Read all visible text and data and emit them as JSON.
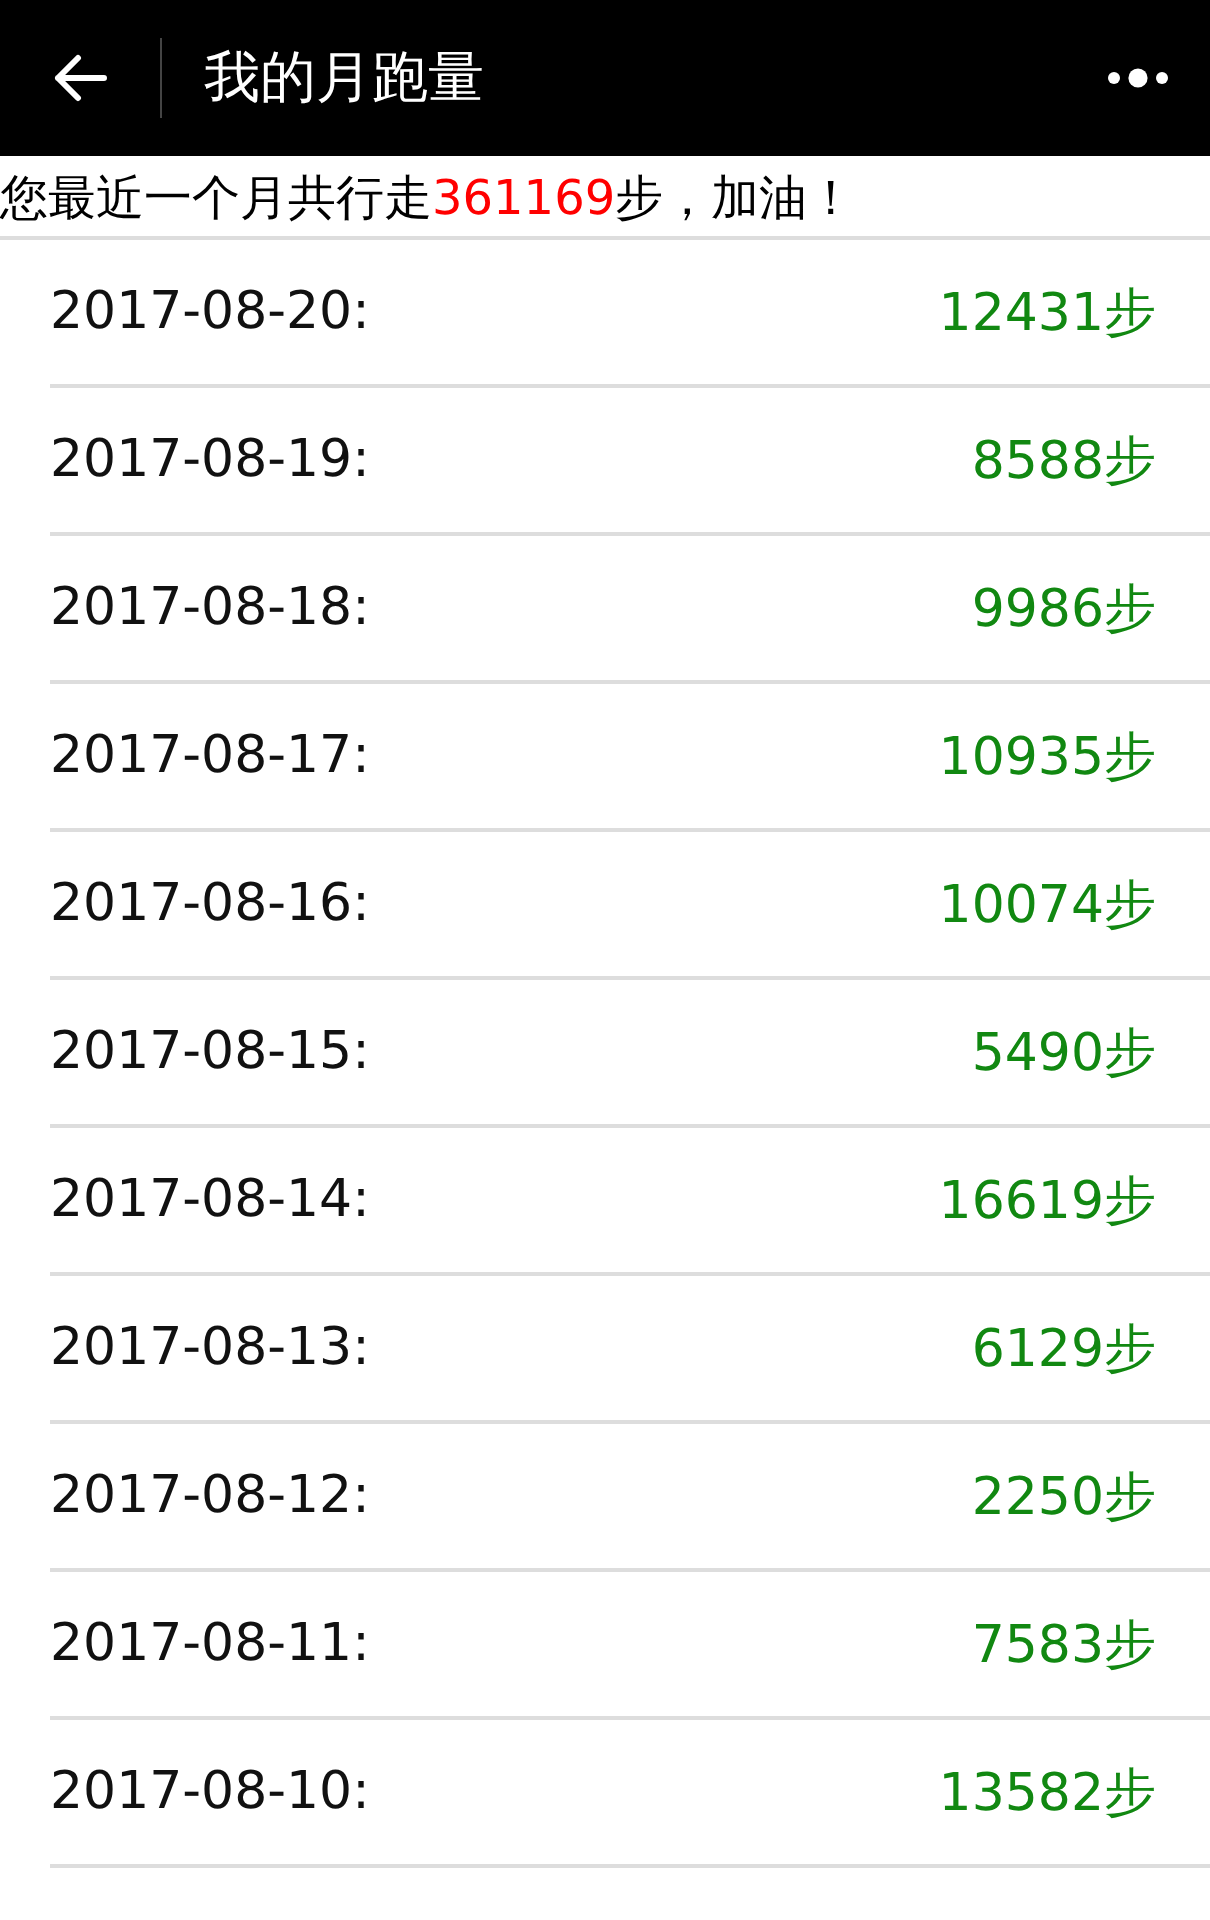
{
  "header": {
    "title": "我的月跑量"
  },
  "summary": {
    "before": "您最近一个月共行走",
    "total": "361169",
    "after": "步，加油！"
  },
  "days": [
    {
      "date": "2017-08-20:",
      "steps": "12431步"
    },
    {
      "date": "2017-08-19:",
      "steps": "8588步"
    },
    {
      "date": "2017-08-18:",
      "steps": "9986步"
    },
    {
      "date": "2017-08-17:",
      "steps": "10935步"
    },
    {
      "date": "2017-08-16:",
      "steps": "10074步"
    },
    {
      "date": "2017-08-15:",
      "steps": "5490步"
    },
    {
      "date": "2017-08-14:",
      "steps": "16619步"
    },
    {
      "date": "2017-08-13:",
      "steps": "6129步"
    },
    {
      "date": "2017-08-12:",
      "steps": "2250步"
    },
    {
      "date": "2017-08-11:",
      "steps": "7583步"
    },
    {
      "date": "2017-08-10:",
      "steps": "13582步"
    }
  ]
}
